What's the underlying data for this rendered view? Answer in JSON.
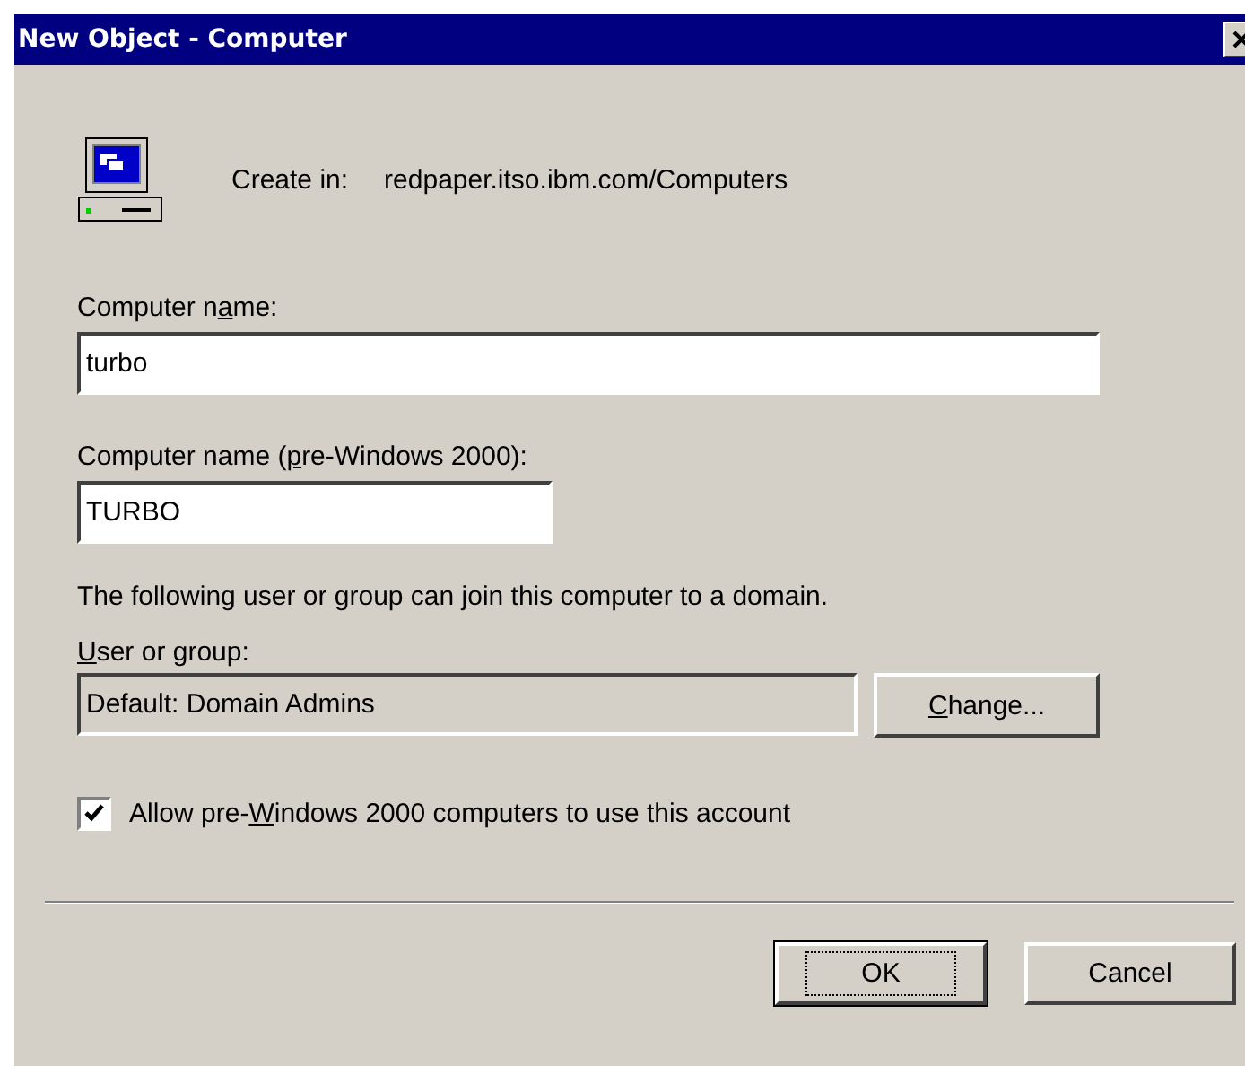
{
  "window": {
    "title": "New Object - Computer"
  },
  "location": {
    "label": "Create in:",
    "value": "redpaper.itso.ibm.com/Computers"
  },
  "fields": [
    {
      "label": {
        "before": "Computer n",
        "key": "a",
        "after": "me:"
      },
      "value": "turbo",
      "kind": "wide",
      "disabled": false
    },
    {
      "label": {
        "before": "Computer name (",
        "key": "p",
        "after": "re-Windows 2000):"
      },
      "value": "TURBO",
      "kind": "narrow",
      "disabled": false
    }
  ],
  "join_note": "The following user or group can join this computer to a domain.",
  "user_group": {
    "label": {
      "key": "U",
      "after": "ser or group:"
    },
    "value": "Default: Domain Admins",
    "disabled": true,
    "button": {
      "key": "C",
      "after": "hange..."
    }
  },
  "option": {
    "label": {
      "before": "Allow pre-",
      "key": "W",
      "after": "indows 2000 computers to use this account"
    },
    "checked": true
  },
  "buttons": [
    {
      "label": "OK",
      "focused": true
    },
    {
      "label": "Cancel",
      "focused": false
    }
  ]
}
